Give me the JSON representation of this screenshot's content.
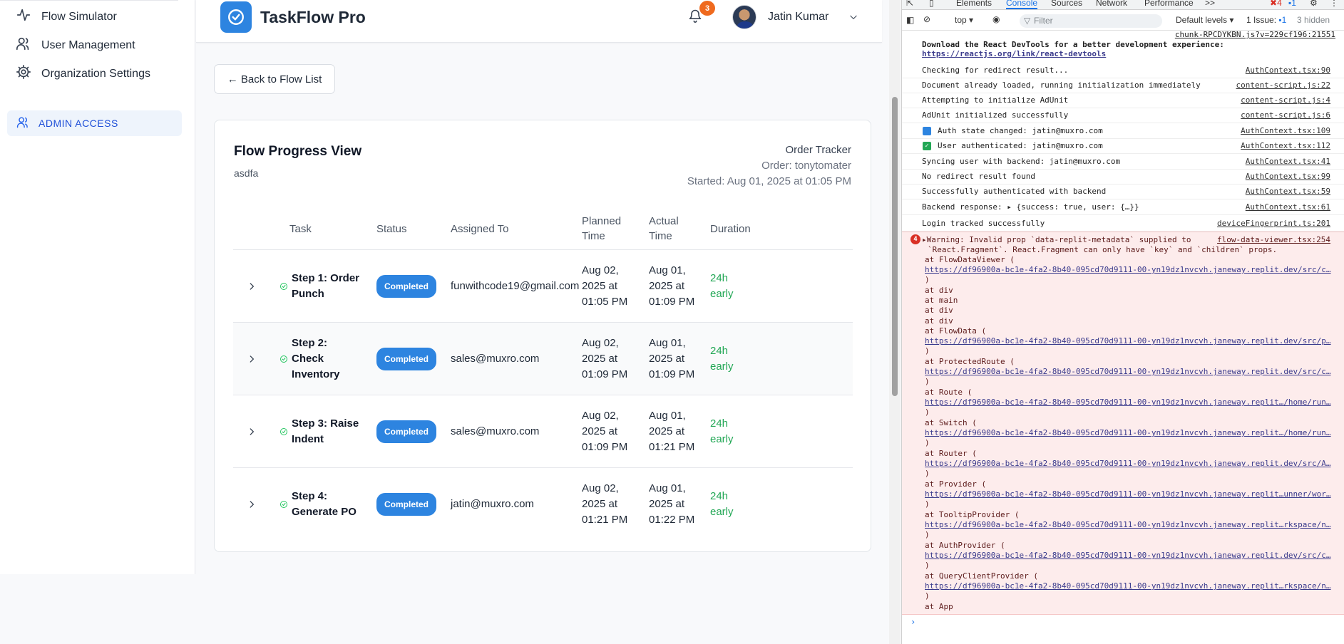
{
  "sidebar": {
    "items": [
      {
        "label": "Flow Simulator",
        "icon": "activity-icon"
      },
      {
        "label": "User Management",
        "icon": "users-icon"
      },
      {
        "label": "Organization Settings",
        "icon": "gear-icon"
      }
    ],
    "admin_label": "ADMIN ACCESS"
  },
  "header": {
    "app_title": "TaskFlow Pro",
    "notification_count": "3",
    "user_name": "Jatin Kumar"
  },
  "back_label": "← Back to Flow List",
  "flow": {
    "title": "Flow Progress View",
    "subtitle": "asdfa",
    "meta_type": "Order Tracker",
    "meta_order": "Order: tonytomater",
    "meta_started": "Started: Aug 01, 2025 at 01:05 PM",
    "columns": {
      "task": "Task",
      "status": "Status",
      "assigned": "Assigned To",
      "planned_1": "Planned",
      "planned_2": "Time",
      "actual_1": "Actual",
      "actual_2": "Time",
      "duration": "Duration"
    },
    "rows": [
      {
        "task_1": "Step 1: Order",
        "task_2": "Punch",
        "task_3": "",
        "status": "Completed",
        "assigned": "funwithcode19@gmail.com",
        "planned_1": "Aug 02,",
        "planned_2": "2025 at",
        "planned_3": "01:05 PM",
        "actual_1": "Aug 01,",
        "actual_2": "2025 at",
        "actual_3": "01:09 PM",
        "dur_1": "24h",
        "dur_2": "early"
      },
      {
        "task_1": "Step 2:",
        "task_2": "Check",
        "task_3": "Inventory",
        "status": "Completed",
        "assigned": "sales@muxro.com",
        "planned_1": "Aug 02,",
        "planned_2": "2025 at",
        "planned_3": "01:09 PM",
        "actual_1": "Aug 01,",
        "actual_2": "2025 at",
        "actual_3": "01:09 PM",
        "dur_1": "24h",
        "dur_2": "early"
      },
      {
        "task_1": "Step 3: Raise",
        "task_2": "Indent",
        "task_3": "",
        "status": "Completed",
        "assigned": "sales@muxro.com",
        "planned_1": "Aug 02,",
        "planned_2": "2025 at",
        "planned_3": "01:09 PM",
        "actual_1": "Aug 01,",
        "actual_2": "2025 at",
        "actual_3": "01:21 PM",
        "dur_1": "24h",
        "dur_2": "early"
      },
      {
        "task_1": "Step 4:",
        "task_2": "Generate PO",
        "task_3": "",
        "status": "Completed",
        "assigned": "jatin@muxro.com",
        "planned_1": "Aug 02,",
        "planned_2": "2025 at",
        "planned_3": "01:21 PM",
        "actual_1": "Aug 01,",
        "actual_2": "2025 at",
        "actual_3": "01:22 PM",
        "dur_1": "24h",
        "dur_2": "early"
      }
    ]
  },
  "devtools": {
    "tabs": [
      "Elements",
      "Console",
      "Sources",
      "Network",
      "Performance",
      ">>"
    ],
    "error_count": "4",
    "message_count": "1",
    "context": "top",
    "filter_placeholder": "Filter",
    "levels": "Default levels",
    "issues": "1 Issue:",
    "issues_count": "1",
    "hidden": "3 hidden",
    "top_src": "chunk-RPCDYKBN.js?v=229cf196:21551",
    "react_msg_1": "Download the React DevTools for a better development experience:",
    "react_msg_2": "https://reactjs.org/link/react-devtools",
    "logs": [
      {
        "msg": "Checking for redirect result...",
        "src": "AuthContext.tsx:90"
      },
      {
        "msg": "Document already loaded, running initialization immediately",
        "src": "content-script.js:22"
      },
      {
        "msg": "Attempting to initialize AdUnit",
        "src": "content-script.js:4"
      },
      {
        "msg": "AdUnit initialized successfully",
        "src": "content-script.js:6"
      },
      {
        "msg": "Auth state changed: jatin@muxro.com",
        "src": "AuthContext.tsx:109"
      },
      {
        "msg": "User authenticated: jatin@muxro.com",
        "src": "AuthContext.tsx:112"
      },
      {
        "msg": "Syncing user with backend: jatin@muxro.com",
        "src": "AuthContext.tsx:41"
      },
      {
        "msg": "No redirect result found",
        "src": "AuthContext.tsx:99"
      },
      {
        "msg": "Successfully authenticated with backend",
        "src": "AuthContext.tsx:59"
      },
      {
        "msg": "Backend response:  ▸ {success: true, user: {…}}",
        "src": "AuthContext.tsx:61"
      },
      {
        "msg": "Login tracked successfully",
        "src": "deviceFingerprint.ts:201"
      }
    ],
    "warning": {
      "count": "4",
      "line1": "▸Warning: Invalid prop `data-replit-metadata` supplied to",
      "line2": "`React.Fragment`. React.Fragment can only have `key` and `children` props.",
      "src": "flow-data-viewer.tsx:254",
      "stack": [
        {
          "text": "    at FlowDataViewer (",
          "link": "https://df96900a-bc1e-4fa2-8b40-095cd70d9111-00-yn19dz1nvcvh.janeway.replit.dev/src/c…"
        },
        {
          "text": "    at div"
        },
        {
          "text": "    at main"
        },
        {
          "text": "    at div"
        },
        {
          "text": "    at div"
        },
        {
          "text": "    at FlowData (",
          "link": "https://df96900a-bc1e-4fa2-8b40-095cd70d9111-00-yn19dz1nvcvh.janeway.replit.dev/src/p…"
        },
        {
          "text": "    at ProtectedRoute (",
          "link": "https://df96900a-bc1e-4fa2-8b40-095cd70d9111-00-yn19dz1nvcvh.janeway.replit.dev/src/c…"
        },
        {
          "text": "    at Route (",
          "link": "https://df96900a-bc1e-4fa2-8b40-095cd70d9111-00-yn19dz1nvcvh.janeway.replit…/home/run…"
        },
        {
          "text": "    at Switch (",
          "link": "https://df96900a-bc1e-4fa2-8b40-095cd70d9111-00-yn19dz1nvcvh.janeway.replit…/home/run…"
        },
        {
          "text": "    at Router (",
          "link": "https://df96900a-bc1e-4fa2-8b40-095cd70d9111-00-yn19dz1nvcvh.janeway.replit.dev/src/A…"
        },
        {
          "text": "    at Provider (",
          "link": "https://df96900a-bc1e-4fa2-8b40-095cd70d9111-00-yn19dz1nvcvh.janeway.replit…unner/wor…"
        },
        {
          "text": "    at TooltipProvider (",
          "link": "https://df96900a-bc1e-4fa2-8b40-095cd70d9111-00-yn19dz1nvcvh.janeway.replit…rkspace/n…"
        },
        {
          "text": "    at AuthProvider (",
          "link": "https://df96900a-bc1e-4fa2-8b40-095cd70d9111-00-yn19dz1nvcvh.janeway.replit.dev/src/c…"
        },
        {
          "text": "    at QueryClientProvider (",
          "link": "https://df96900a-bc1e-4fa2-8b40-095cd70d9111-00-yn19dz1nvcvh.janeway.replit…rkspace/n…"
        },
        {
          "text": "    at App"
        }
      ]
    },
    "prompt": "›"
  },
  "colors": {
    "brand": "#2d84e0",
    "success": "#22a755",
    "badge_orange": "#ef6a1e",
    "warning_bg": "#fdecec"
  }
}
